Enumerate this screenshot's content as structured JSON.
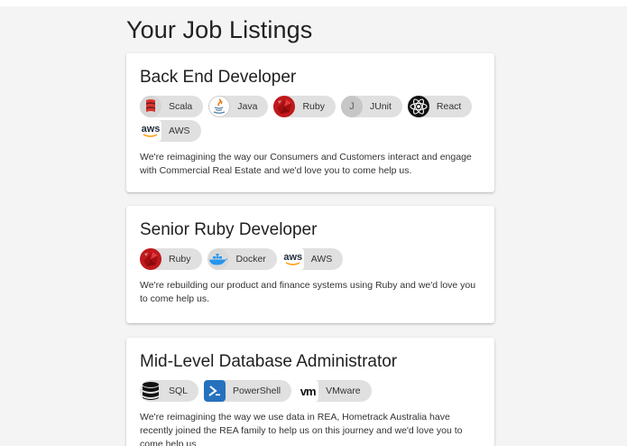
{
  "page": {
    "title": "Your Job Listings"
  },
  "jobs": [
    {
      "title": "Back End Developer",
      "tags": [
        {
          "label": "Scala",
          "icon": "scala-icon"
        },
        {
          "label": "Java",
          "icon": "java-icon"
        },
        {
          "label": "Ruby",
          "icon": "ruby-icon"
        },
        {
          "label": "JUnit",
          "icon": "junit-icon",
          "letter": "J"
        },
        {
          "label": "React",
          "icon": "react-icon"
        },
        {
          "label": "AWS",
          "icon": "aws-icon",
          "logo_text": "aws"
        }
      ],
      "description": "We're reimagining the way our Consumers and Customers interact and engage with Commercial Real Estate and we'd love you to come help us."
    },
    {
      "title": "Senior Ruby Developer",
      "tags": [
        {
          "label": "Ruby",
          "icon": "ruby-icon"
        },
        {
          "label": "Docker",
          "icon": "docker-icon"
        },
        {
          "label": "AWS",
          "icon": "aws-icon",
          "logo_text": "aws"
        }
      ],
      "description": "We're rebuilding our product and finance systems using Ruby and we'd love you to come help us."
    },
    {
      "title": "Mid-Level Database Administrator",
      "tags": [
        {
          "label": "SQL",
          "icon": "database-icon"
        },
        {
          "label": "PowerShell",
          "icon": "powershell-icon"
        },
        {
          "label": "VMware",
          "icon": "vmware-icon",
          "logo_text": "vm"
        }
      ],
      "description": "We're reimagining the way we use data in REA, Hometrack Australia have recently joined the REA family to help us on this journey and we'd love you to come help us"
    }
  ],
  "colors": {
    "background": "#f4f4f4",
    "chip": "#e0e0e0",
    "ruby": "#c0191c",
    "scala": "#dc322f",
    "docker": "#2496ed",
    "powershell": "#2671be",
    "aws_orange": "#ff9900"
  }
}
